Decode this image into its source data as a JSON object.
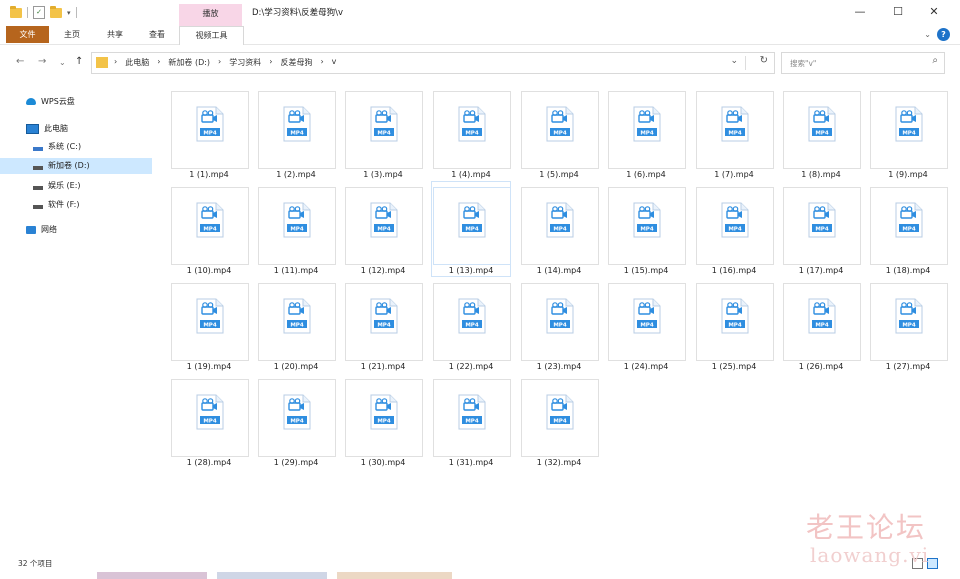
{
  "window": {
    "title_path": "D:\\学习资料\\反差母狗\\v",
    "contextual_tab": "播放",
    "controls": {
      "minimize": "—",
      "maximize": "☐",
      "close": "✕"
    }
  },
  "quick_access": {
    "dropdown": "▾"
  },
  "ribbon": {
    "tabs": [
      "文件",
      "主页",
      "共享",
      "查看",
      "视频工具"
    ],
    "expand": "⌄",
    "help": "?"
  },
  "nav": {
    "back": "←",
    "forward": "→",
    "recent": "⌄",
    "up": "↑",
    "breadcrumbs": [
      "›",
      "此电脑",
      "›",
      "新加卷 (D:)",
      "›",
      "学习资料",
      "›",
      "反差母狗",
      "›",
      "v"
    ],
    "dropdown": "⌄",
    "refresh": "↻",
    "search_placeholder": "搜索\"v\"",
    "search_icon": "⌕"
  },
  "sidebar": {
    "items": [
      {
        "label": "WPS云盘",
        "icon": "cloud-icon"
      },
      {
        "label": "此电脑",
        "icon": "computer-icon"
      },
      {
        "label": "系统 (C:)",
        "icon": "drive-icon"
      },
      {
        "label": "新加卷 (D:)",
        "icon": "drive-icon",
        "selected": true
      },
      {
        "label": "娱乐 (E:)",
        "icon": "drive-icon"
      },
      {
        "label": "软件 (F:)",
        "icon": "drive-icon"
      },
      {
        "label": "网络",
        "icon": "network-icon"
      }
    ]
  },
  "files": {
    "icon_badge": "MP4",
    "selected_index": 12,
    "items": [
      "1 (1).mp4",
      "1 (2).mp4",
      "1 (3).mp4",
      "1 (4).mp4",
      "1 (5).mp4",
      "1 (6).mp4",
      "1 (7).mp4",
      "1 (8).mp4",
      "1 (9).mp4",
      "1 (10).mp4",
      "1 (11).mp4",
      "1 (12).mp4",
      "1 (13).mp4",
      "1 (14).mp4",
      "1 (15).mp4",
      "1 (16).mp4",
      "1 (17).mp4",
      "1 (18).mp4",
      "1 (19).mp4",
      "1 (20).mp4",
      "1 (21).mp4",
      "1 (22).mp4",
      "1 (23).mp4",
      "1 (24).mp4",
      "1 (25).mp4",
      "1 (26).mp4",
      "1 (27).mp4",
      "1 (28).mp4",
      "1 (29).mp4",
      "1 (30).mp4",
      "1 (31).mp4",
      "1 (32).mp4"
    ]
  },
  "status_bar": {
    "count": "32 个项目"
  },
  "watermark": {
    "chinese": "老王论坛",
    "latin": "laowang.vi"
  },
  "colors": {
    "accent": "#1e73c9",
    "file_tab": "#b6651d",
    "context_tab": "#f8d6e7",
    "selection": "#cde8ff",
    "mp4_badge": "#2f8ee0"
  }
}
